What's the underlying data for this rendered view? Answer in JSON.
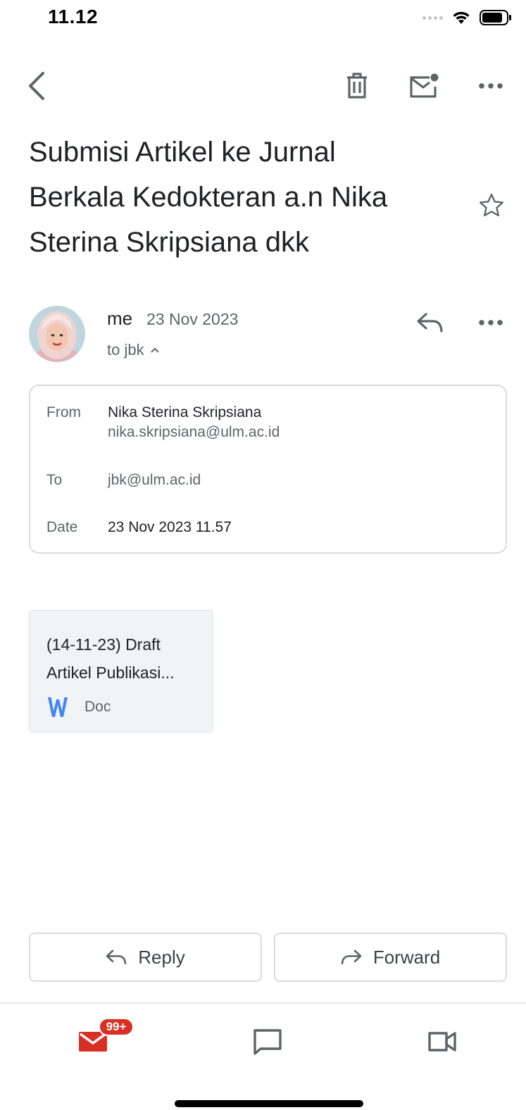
{
  "status_bar": {
    "time": "11.12"
  },
  "email": {
    "subject_lines": [
      "Submisi Artikel ke Jurnal",
      "Berkala Kedokteran a.n Nika",
      "Sterina Skripsiana dkk"
    ],
    "sender": {
      "name": "me",
      "date": "23 Nov 2023",
      "recipients": "to jbk"
    },
    "details": {
      "from_label": "From",
      "from_name": "Nika Sterina Skripsiana",
      "from_email": "nika.skripsiana@ulm.ac.id",
      "to_label": "To",
      "to_value": "jbk@ulm.ac.id",
      "date_label": "Date",
      "date_value": "23 Nov 2023 11.57"
    },
    "attachment": {
      "title_line1": "(14-11-23) Draft",
      "title_line2": "Artikel Publikasi...",
      "type_label": "Doc",
      "type_glyph": "W",
      "type_color": "#4285f4"
    }
  },
  "actions": {
    "reply_label": "Reply",
    "forward_label": "Forward"
  },
  "bottom_nav": {
    "mail_badge": "99+",
    "accent": "#d93025"
  },
  "icons": {
    "back": "back-arrow-icon",
    "delete": "trash-icon",
    "unread": "mark-unread-icon",
    "more": "more-horizontal-icon",
    "star": "star-outline-icon",
    "reply": "reply-icon",
    "forward": "forward-icon",
    "chat": "chat-icon",
    "meet": "video-icon"
  }
}
